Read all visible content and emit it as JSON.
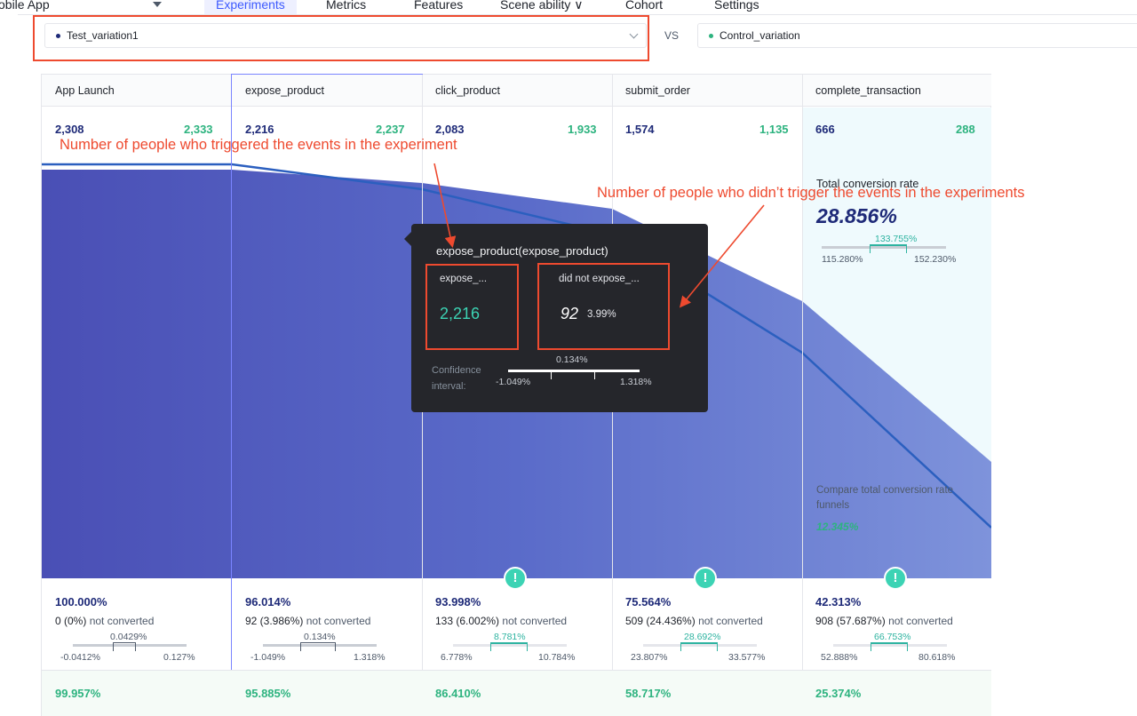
{
  "nav": {
    "app_name": "obile App",
    "tabs": [
      {
        "label": "Experiments",
        "active": true
      },
      {
        "label": "Metrics"
      },
      {
        "label": "Features"
      },
      {
        "label": "Scene ability ∨"
      },
      {
        "label": "Cohort"
      },
      {
        "label": "Settings"
      }
    ]
  },
  "compare": {
    "left": {
      "label": "Test_variation1",
      "dot_color": "#1e2a78"
    },
    "vs": "VS",
    "right": {
      "label": "Control_variation",
      "dot_color": "#2db37f"
    }
  },
  "columns": [
    {
      "name": "App Launch",
      "count_a": "2,308",
      "count_b": "2,333",
      "pct": "100.000%",
      "nc_a": "0 (0%)",
      "nc_b": "not converted",
      "ci": {
        "mid": "0.0429%",
        "lo": "-0.0412%",
        "hi": "0.127%",
        "significant": false
      },
      "pct2": "99.957%",
      "alert": false
    },
    {
      "name": "expose_product",
      "count_a": "2,216",
      "count_b": "2,237",
      "pct": "96.014%",
      "nc_a": "92 (3.986%)",
      "nc_b": "not converted",
      "ci": {
        "mid": "0.134%",
        "lo": "-1.049%",
        "hi": "1.318%",
        "significant": false
      },
      "pct2": "95.885%",
      "alert": false
    },
    {
      "name": "click_product",
      "count_a": "2,083",
      "count_b": "1,933",
      "pct": "93.998%",
      "nc_a": "133  (6.002%)",
      "nc_b": "not converted",
      "ci": {
        "mid": "8.781%",
        "lo": "6.778%",
        "hi": "10.784%",
        "significant": true
      },
      "pct2": "86.410%",
      "alert": true
    },
    {
      "name": "submit_order",
      "count_a": "1,574",
      "count_b": "1,135",
      "pct": "75.564%",
      "nc_a": "509  (24.436%)",
      "nc_b": "not converted",
      "ci": {
        "mid": "28.692%",
        "lo": "23.807%",
        "hi": "33.577%",
        "significant": true
      },
      "pct2": "58.717%",
      "alert": true
    },
    {
      "name": "complete_transaction",
      "count_a": "666",
      "count_b": "288",
      "pct": "42.313%",
      "nc_a": "908  (57.687%)",
      "nc_b": "not converted",
      "ci": {
        "mid": "66.753%",
        "lo": "52.888%",
        "hi": "80.618%",
        "significant": true
      },
      "pct2": "25.374%",
      "alert": true
    }
  ],
  "conversion": {
    "title": "Total conversion rate",
    "value": "28.856%",
    "ci": {
      "mid": "133.755%",
      "lo": "115.280%",
      "hi": "152.230%"
    },
    "compare_title": "Compare total conversion rate funnels",
    "compare_value": "12.345%"
  },
  "tooltip": {
    "title": "expose_product(expose_product)",
    "left_label": "expose_...",
    "left_value": "2,216",
    "right_label": "did not expose_...",
    "right_value": "92",
    "right_pct": "3.99%",
    "ci_label_1": "Confidence",
    "ci_label_2": "interval:",
    "ci_mid": "0.134%",
    "ci_lo": "-1.049%",
    "ci_hi": "1.318%"
  },
  "annotations": {
    "triggered": "Number of people who triggered the events in the experiment",
    "not_triggered": "Number of people who didn’t trigger the events in the experiments"
  },
  "colors": {
    "accent": "#3d5afe",
    "test": "#1e2a78",
    "control": "#2db37f",
    "annotation": "#ee4a2f",
    "funnel_fill": "#4a52b8"
  }
}
